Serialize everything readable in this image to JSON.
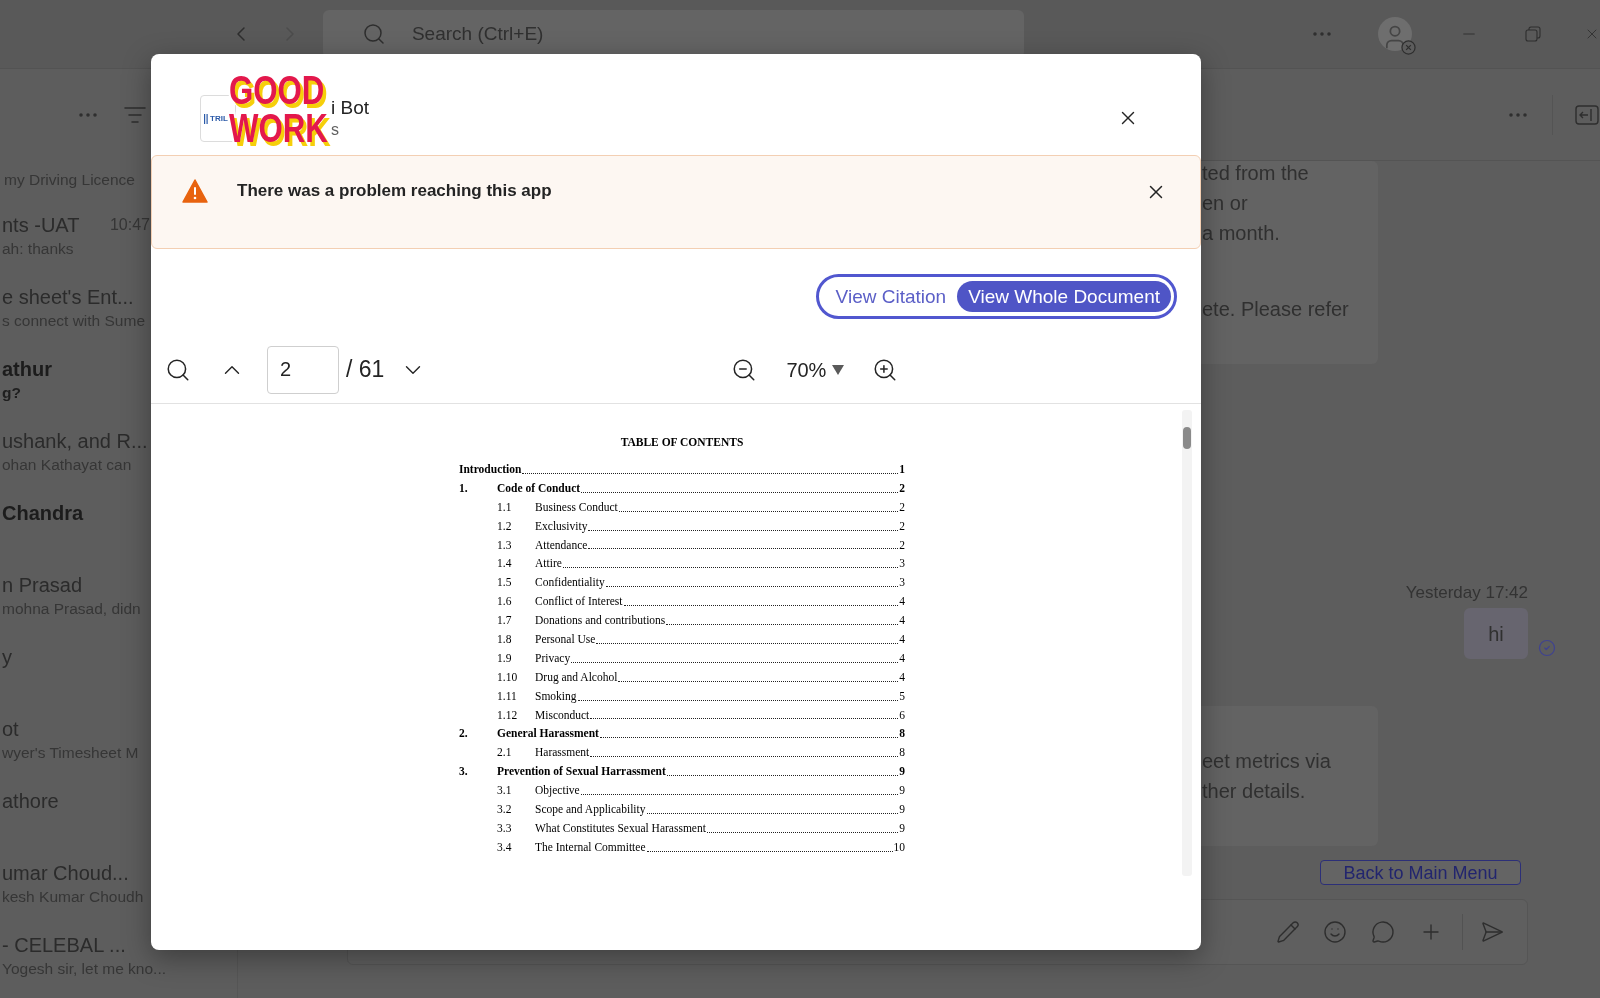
{
  "title_bar": {
    "back": {
      "disabled": false
    },
    "forward": {
      "disabled": true
    },
    "search": {
      "placeholder": "Search (Ctrl+E)"
    }
  },
  "chat_list": [
    {
      "preview": "my Driving Licence",
      "unread": false
    },
    {
      "title": "nts -UAT",
      "time": "10:47",
      "preview": "ah: thanks",
      "unread": false
    },
    {
      "title": "e sheet's Ent...",
      "preview": "s connect with Sume",
      "unread": false
    },
    {
      "title": "athur",
      "preview": "g?",
      "unread": true
    },
    {
      "title": "ushank, and R...",
      "preview": "ohan Kathayat can",
      "unread": false
    },
    {
      "title": "Chandra",
      "unread": true
    },
    {
      "title": "n Prasad",
      "preview": "mohna Prasad, didn",
      "unread": false
    },
    {
      "title": "y",
      "unread": false
    },
    {
      "title": "ot",
      "preview": "wyer's Timesheet M",
      "unread": false
    },
    {
      "title": "athore",
      "unread": false
    },
    {
      "title": "umar Choud...",
      "preview": "kesh Kumar Choudh",
      "unread": false
    },
    {
      "title": "- CELEBAL ...",
      "preview": "Yogesh sir, let me kno...",
      "unread": false
    }
  ],
  "conversation": {
    "messages": [
      {
        "kind": "received",
        "paragraphs": [
          {
            "lines": [
              "ted from the",
              "en or",
              "a month."
            ]
          },
          {
            "lines": [
              "ete. Please refer"
            ]
          }
        ]
      },
      {
        "kind": "sent",
        "time": "Yesterday 17:42",
        "text": "hi"
      },
      {
        "kind": "received",
        "paragraphs": [
          {
            "lines": [
              "eet metrics via",
              "ther details."
            ]
          }
        ]
      }
    ],
    "action_button": "Back to Main Menu"
  },
  "dialog": {
    "app": {
      "logo_text": "TRIL",
      "name": "i Bot",
      "subtitle": "s"
    },
    "sticker": {
      "lines": [
        "GOOD",
        "WORK"
      ]
    },
    "alert": {
      "message": "There was a problem reaching this app"
    },
    "view_toggle": [
      {
        "label": "View Citation",
        "selected": false
      },
      {
        "label": "View Whole Document",
        "selected": true
      }
    ],
    "viewer": {
      "page": "2",
      "total": "/ 61",
      "zoom": "70%"
    },
    "document": {
      "title": "TABLE OF CONTENTS",
      "entries": [
        {
          "title": "Introduction",
          "page": "1"
        },
        {
          "number": "1.",
          "title": "Code of Conduct",
          "page": "2",
          "children": [
            {
              "number": "1.1",
              "title": "Business Conduct",
              "page": "2"
            },
            {
              "number": "1.2",
              "title": "Exclusivity",
              "page": "2"
            },
            {
              "number": "1.3",
              "title": "Attendance",
              "page": "2"
            },
            {
              "number": "1.4",
              "title": "Attire",
              "page": "3"
            },
            {
              "number": "1.5",
              "title": "Confidentiality",
              "page": "3"
            },
            {
              "number": "1.6",
              "title": "Conflict of Interest",
              "page": "4"
            },
            {
              "number": "1.7",
              "title": "Donations and contributions",
              "page": "4"
            },
            {
              "number": "1.8",
              "title": "Personal Use",
              "page": "4"
            },
            {
              "number": "1.9",
              "title": "Privacy",
              "page": "4"
            },
            {
              "number": "1.10",
              "title": "Drug and Alcohol",
              "page": "4"
            },
            {
              "number": "1.11",
              "title": "Smoking",
              "page": "5"
            },
            {
              "number": "1.12",
              "title": "Misconduct",
              "page": "6"
            }
          ]
        },
        {
          "number": "2.",
          "title": "General Harassment",
          "page": "8",
          "children": [
            {
              "number": "2.1",
              "title": "Harassment",
              "page": "8"
            }
          ]
        },
        {
          "number": "3.",
          "title": "Prevention of Sexual Harrassment",
          "page": "9",
          "children": [
            {
              "number": "3.1",
              "title": "Objective",
              "page": "9"
            },
            {
              "number": "3.2",
              "title": "Scope and Applicability",
              "page": "9"
            },
            {
              "number": "3.3",
              "title": "What Constitutes Sexual Harassment",
              "page": "9"
            },
            {
              "number": "3.4",
              "title": "The Internal Committee",
              "page": "10"
            }
          ]
        }
      ]
    }
  }
}
